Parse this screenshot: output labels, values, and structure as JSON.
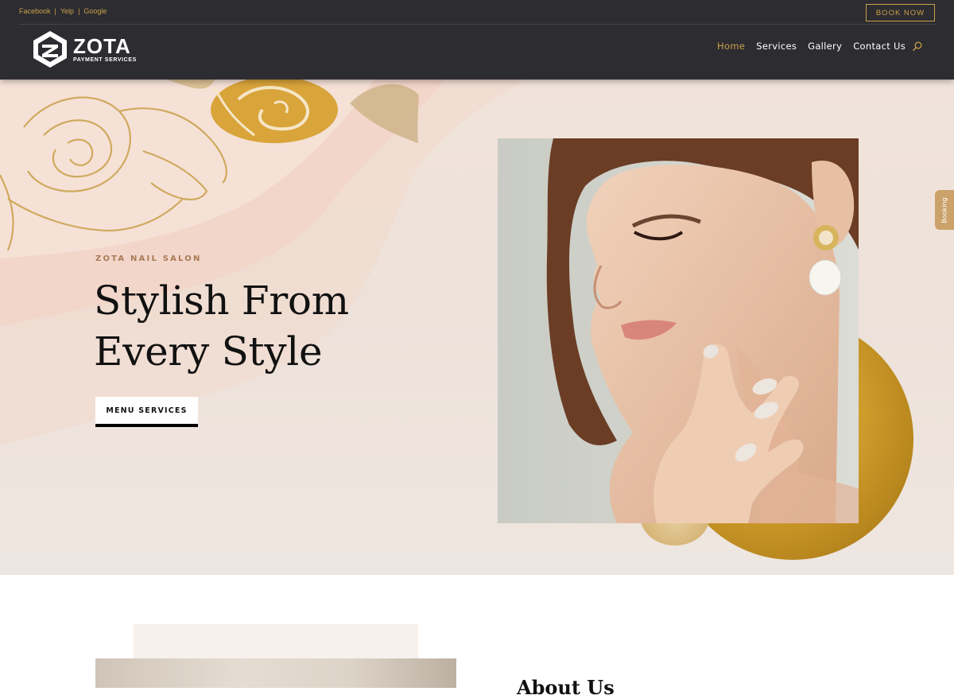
{
  "topbar": {
    "social_links": [
      "Facebook",
      "Yelp",
      "Google"
    ],
    "separator": "|",
    "book_now_label": "BOOK NOW"
  },
  "brand": {
    "name": "ZOTA",
    "tagline": "PAYMENT SERVICES"
  },
  "nav": {
    "items": [
      {
        "label": "Home",
        "active": true
      },
      {
        "label": "Services",
        "active": false
      },
      {
        "label": "Gallery",
        "active": false
      },
      {
        "label": "Contact Us",
        "active": false
      }
    ],
    "search_icon": "search-icon"
  },
  "hero": {
    "eyebrow": "ZOTA NAIL SALON",
    "headline_line1": "Stylish From",
    "headline_line2": "Every Style",
    "cta_label": "MENU SERVICES"
  },
  "side_tab": {
    "label": "Booking"
  },
  "about": {
    "title": "About Us"
  },
  "colors": {
    "header_bg": "#2d2c31",
    "accent_gold": "#c9a14a",
    "hero_bg": "#efe4dc",
    "cta_border": "#000000"
  }
}
